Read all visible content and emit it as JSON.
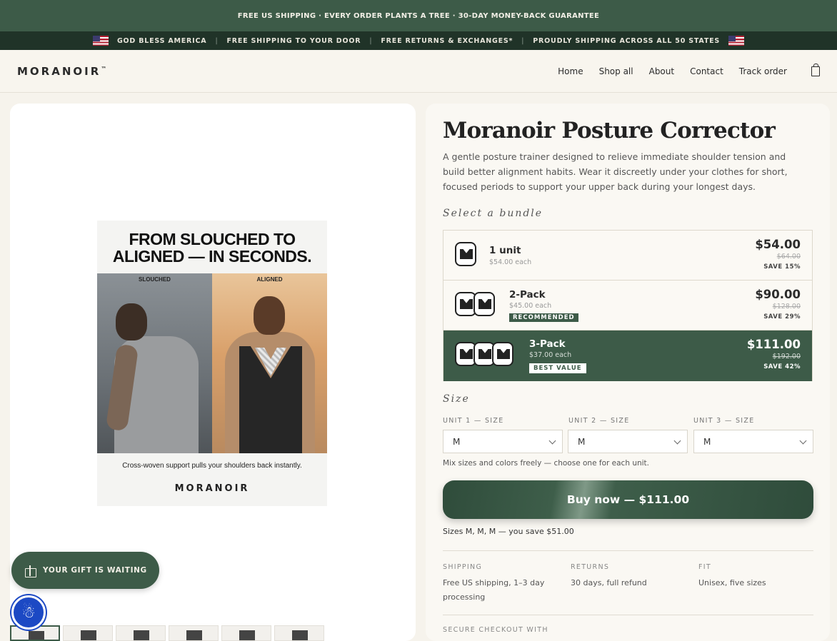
{
  "announcement": {
    "main": "FREE US SHIPPING · EVERY ORDER PLANTS A TREE · 30-DAY MONEY-BACK GUARANTEE",
    "items": [
      "GOD BLESS AMERICA",
      "FREE SHIPPING TO YOUR DOOR",
      "FREE RETURNS & EXCHANGES*",
      "PROUDLY SHIPPING ACROSS ALL 50 STATES"
    ]
  },
  "nav": {
    "logo": "MORANOIR",
    "logo_mark": "™",
    "links": [
      "Home",
      "Shop all",
      "About",
      "Contact",
      "Track order"
    ]
  },
  "gallery": {
    "headline_line1": "FROM SLOUCHED TO",
    "headline_line2": "ALIGNED — IN SECONDS.",
    "label_left": "SLOUCHED",
    "label_right": "ALIGNED",
    "caption": "Cross-woven support pulls your shoulders back instantly.",
    "brand": "MORANOIR"
  },
  "gift": {
    "label": "YOUR GIFT IS WAITING"
  },
  "product": {
    "title": "Moranoir Posture Corrector",
    "description": "A gentle posture trainer designed to relieve immediate shoulder tension and build better alignment habits. Wear it discreetly under your clothes for short, focused periods to support your upper back during your longest days.",
    "bundle_label": "Select a bundle",
    "bundles": [
      {
        "name": "1 unit",
        "each": "$54.00 each",
        "price": "$54.00",
        "compare": "$64.00",
        "save": "SAVE 15%",
        "tag": ""
      },
      {
        "name": "2-Pack",
        "each": "$45.00 each",
        "price": "$90.00",
        "compare": "$128.00",
        "save": "SAVE 29%",
        "tag": "RECOMMENDED"
      },
      {
        "name": "3-Pack",
        "each": "$37.00 each",
        "price": "$111.00",
        "compare": "$192.00",
        "save": "SAVE 42%",
        "tag": "BEST VALUE"
      }
    ],
    "selected_bundle": 2,
    "size_label": "Size",
    "units": [
      {
        "label": "UNIT 1 — SIZE",
        "value": "M"
      },
      {
        "label": "UNIT 2 — SIZE",
        "value": "M"
      },
      {
        "label": "UNIT 3 — SIZE",
        "value": "M"
      }
    ],
    "mix_note": "Mix sizes and colors freely — choose one for each unit.",
    "buy_label": "Buy now — $111.00",
    "summary": "Sizes M, M, M — you save $51.00",
    "info": [
      {
        "head": "SHIPPING",
        "value": "Free US shipping, 1–3 day processing"
      },
      {
        "head": "RETURNS",
        "value": "30 days, full refund"
      },
      {
        "head": "FIT",
        "value": "Unisex, five sizes"
      }
    ],
    "secure_label": "SECURE CHECKOUT WITH"
  },
  "colors": {
    "brand_green": "#3d5b48",
    "dark_green": "#203328",
    "background": "#f6f3ec"
  }
}
